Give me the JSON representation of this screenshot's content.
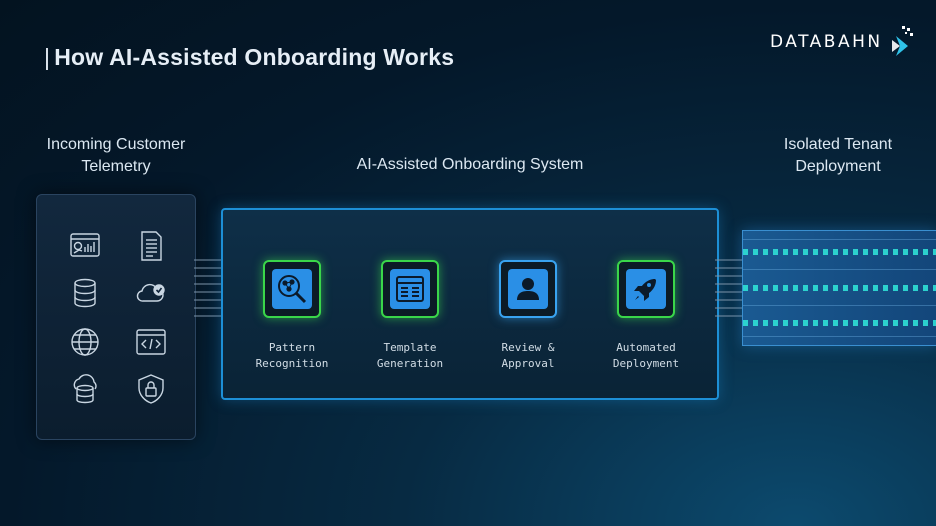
{
  "title": "How AI-Assisted Onboarding Works",
  "logo": {
    "text": "DATABAHN",
    "icon": "databahn-arrow-icon"
  },
  "columns": {
    "left": {
      "heading_line1": "Incoming Customer",
      "heading_line2": "Telemetry"
    },
    "middle": {
      "heading": "AI-Assisted Onboarding System"
    },
    "right": {
      "heading_line1": "Isolated Tenant",
      "heading_line2": "Deployment"
    }
  },
  "telemetry_sources": [
    "dashboard-icon",
    "document-icon",
    "database-icon",
    "cloud-check-icon",
    "globe-icon",
    "code-window-icon",
    "cloud-storage-icon",
    "security-shield-icon"
  ],
  "steps": [
    {
      "label": "Pattern\nRecognition",
      "icon": "pattern-search-icon",
      "accent": "#3ad64a"
    },
    {
      "label": "Template\nGeneration",
      "icon": "template-table-icon",
      "accent": "#3ad64a"
    },
    {
      "label": "Review &\nApproval",
      "icon": "user-approval-icon",
      "accent": "#39a3f0"
    },
    {
      "label": "Automated\nDeployment",
      "icon": "rocket-icon",
      "accent": "#3ad64a"
    }
  ],
  "colors": {
    "primary_blue": "#1d8fd6",
    "green_glow": "#3ad64a",
    "teal_data": "#2ee0d6"
  }
}
